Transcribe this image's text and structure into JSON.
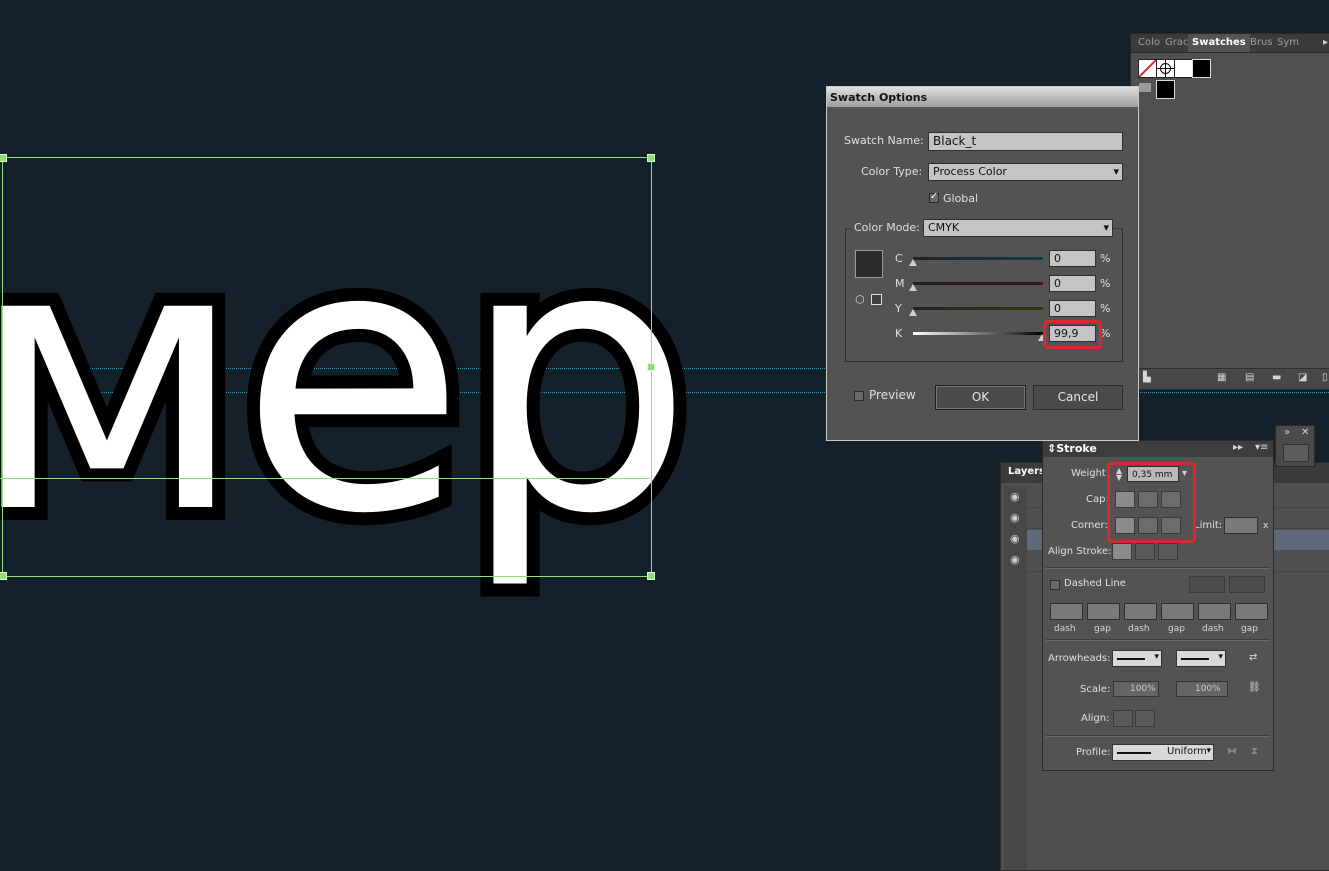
{
  "canvas": {
    "artwork_text": "мер"
  },
  "swatches_panel": {
    "tabs": [
      "Colo",
      "Grac",
      "Swatches",
      "Brus",
      "Sym"
    ],
    "active_tab": "Swatches"
  },
  "swatch_options": {
    "title": "Swatch Options",
    "swatch_name_label": "Swatch Name:",
    "swatch_name_value": "Black_t",
    "color_type_label": "Color Type:",
    "color_type_value": "Process Color",
    "global_label": "Global",
    "global_checked": true,
    "color_mode_label": "Color Mode:",
    "color_mode_value": "CMYK",
    "channels": [
      {
        "label": "C",
        "value": "0",
        "unit": "%"
      },
      {
        "label": "M",
        "value": "0",
        "unit": "%"
      },
      {
        "label": "Y",
        "value": "0",
        "unit": "%"
      },
      {
        "label": "K",
        "value": "99,9",
        "unit": "%"
      }
    ],
    "preview_label": "Preview",
    "ok_label": "OK",
    "cancel_label": "Cancel"
  },
  "layers_panel": {
    "tab": "Layers"
  },
  "stroke_panel": {
    "title": "Stroke",
    "weight_label": "Weight:",
    "weight_value": "0,35 mm",
    "cap_label": "Cap:",
    "corner_label": "Corner:",
    "limit_label": "Limit:",
    "limit_unit": "x",
    "align_label": "Align Stroke:",
    "dashed_label": "Dashed Line",
    "dash_labels": [
      "dash",
      "gap",
      "dash",
      "gap",
      "dash",
      "gap"
    ],
    "arrowheads_label": "Arrowheads:",
    "scale_label": "Scale:",
    "scale_start": "100%",
    "scale_end": "100%",
    "align_arrow_label": "Align:",
    "profile_label": "Profile:",
    "profile_value": "Uniform"
  },
  "colors": {
    "highlight": "#e0262c",
    "selection": "#8fe07a",
    "canvas": "#14202a"
  }
}
